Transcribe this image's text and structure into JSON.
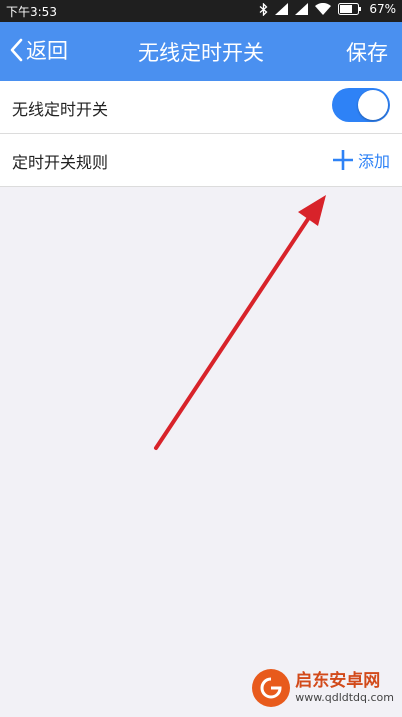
{
  "status_bar": {
    "time": "下午3:53",
    "battery_percent": "67%",
    "icons": [
      "bluetooth-icon",
      "signal-icon",
      "signal-icon",
      "wifi-icon",
      "battery-icon"
    ]
  },
  "nav": {
    "back_label": "返回",
    "title": "无线定时开关",
    "save_label": "保存",
    "color": "#4a90f0"
  },
  "rows": [
    {
      "label": "无线定时开关",
      "control": "toggle",
      "toggle_on": true
    },
    {
      "label": "定时开关规则",
      "control": "add",
      "add_label": "添加"
    }
  ],
  "annotation": {
    "type": "arrow",
    "color": "#d8232a"
  },
  "watermark": {
    "name": "启东安卓网",
    "url": "www.qdldtdq.com"
  },
  "colors": {
    "accent": "#2e82f6",
    "background": "#f2f1f6",
    "statusbar": "#1f1f1f"
  }
}
